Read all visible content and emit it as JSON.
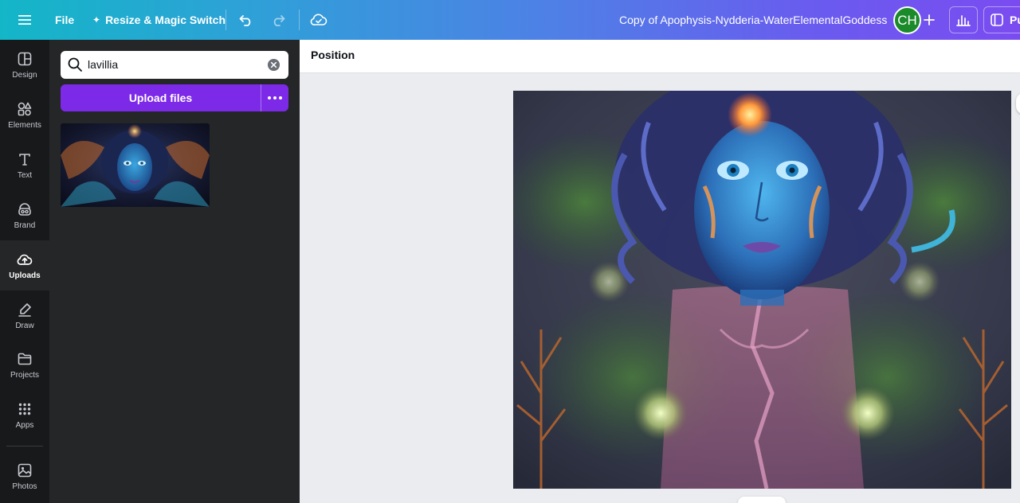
{
  "topbar": {
    "file_label": "File",
    "resize_label": "Resize & Magic Switch",
    "doc_title": "Copy of Apophysis-Nydderia-WaterElementalGoddess",
    "avatar_initials": "CH",
    "publish_label": "Pu",
    "avatar_color": "#1b8a2a"
  },
  "rail": {
    "items": [
      {
        "label": "Design",
        "icon": "design-icon"
      },
      {
        "label": "Elements",
        "icon": "elements-icon"
      },
      {
        "label": "Text",
        "icon": "text-icon"
      },
      {
        "label": "Brand",
        "icon": "brand-icon"
      },
      {
        "label": "Uploads",
        "icon": "uploads-icon",
        "active": true
      },
      {
        "label": "Draw",
        "icon": "draw-icon"
      },
      {
        "label": "Projects",
        "icon": "projects-icon"
      },
      {
        "label": "Apps",
        "icon": "apps-icon"
      },
      {
        "label": "Photos",
        "icon": "photos-icon"
      }
    ]
  },
  "panel": {
    "search_value": "lavillia",
    "upload_label": "Upload files"
  },
  "context_bar": {
    "position_label": "Position"
  },
  "colors": {
    "accent_purple": "#7d2ae8",
    "rail_bg": "#18191b",
    "panel_bg": "#252627"
  }
}
